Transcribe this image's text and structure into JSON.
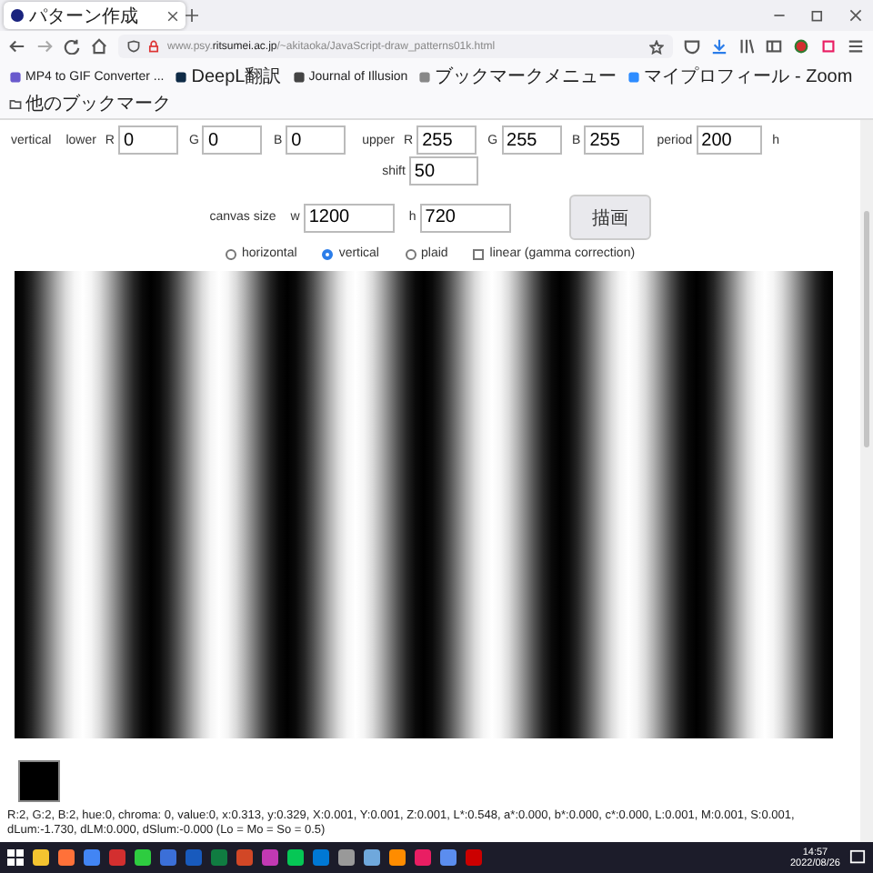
{
  "browser": {
    "tab": {
      "title": "パターン作成"
    },
    "url": "www.psy.**ritsumei.ac.jp**/~akitaoka/JavaScript-draw_patterns01k.html",
    "bookmarks": [
      {
        "label": "MP4 to GIF Converter ..."
      },
      {
        "label": "DeepL翻訳"
      },
      {
        "label": "Journal of Illusion"
      },
      {
        "label": "ブックマークメニュー"
      },
      {
        "label": "マイプロフィール - Zoom"
      }
    ],
    "other_bookmarks": "他のブックマーク"
  },
  "form": {
    "mode_label": "vertical",
    "lower": {
      "label": "lower",
      "fields": [
        {
          "label": "R",
          "value": "0"
        },
        {
          "label": "G",
          "value": "0"
        },
        {
          "label": "B",
          "value": "0"
        }
      ]
    },
    "upper": {
      "label": "upper",
      "fields": [
        {
          "label": "R",
          "value": "255"
        },
        {
          "label": "G",
          "value": "255"
        },
        {
          "label": "B",
          "value": "255"
        }
      ]
    },
    "period": {
      "label": "period",
      "value": "200"
    },
    "trailing": "h",
    "shift": {
      "label": "shift",
      "value": "50"
    },
    "canvas": {
      "label": "canvas size",
      "fields": [
        {
          "label": "w",
          "value": "1200"
        },
        {
          "label": "h",
          "value": "720"
        }
      ]
    },
    "draw_button": "描画",
    "options": [
      {
        "kind": "radio",
        "label": "horizontal",
        "selected": false
      },
      {
        "kind": "radio",
        "label": "vertical",
        "selected": true
      },
      {
        "kind": "radio",
        "label": "plaid",
        "selected": false
      },
      {
        "kind": "checkbox",
        "label": "linear (gamma correction)",
        "checked": false
      }
    ]
  },
  "status_text": "R:2, G:2, B:2, hue:0, chroma: 0, value:0, x:0.313, y:0.329, X:0.001, Y:0.001, Z:0.001, L*:0.548, a*:0.000, b*:0.000, c*:0.000, L:0.001, M:0.001, S:0.001, dLum:-1.730, dLM:0.000, dSlum:-0.000 (Lo = Mo = So = 0.5)",
  "taskbar": {
    "time": "14:57",
    "date": "2022/08/26"
  }
}
